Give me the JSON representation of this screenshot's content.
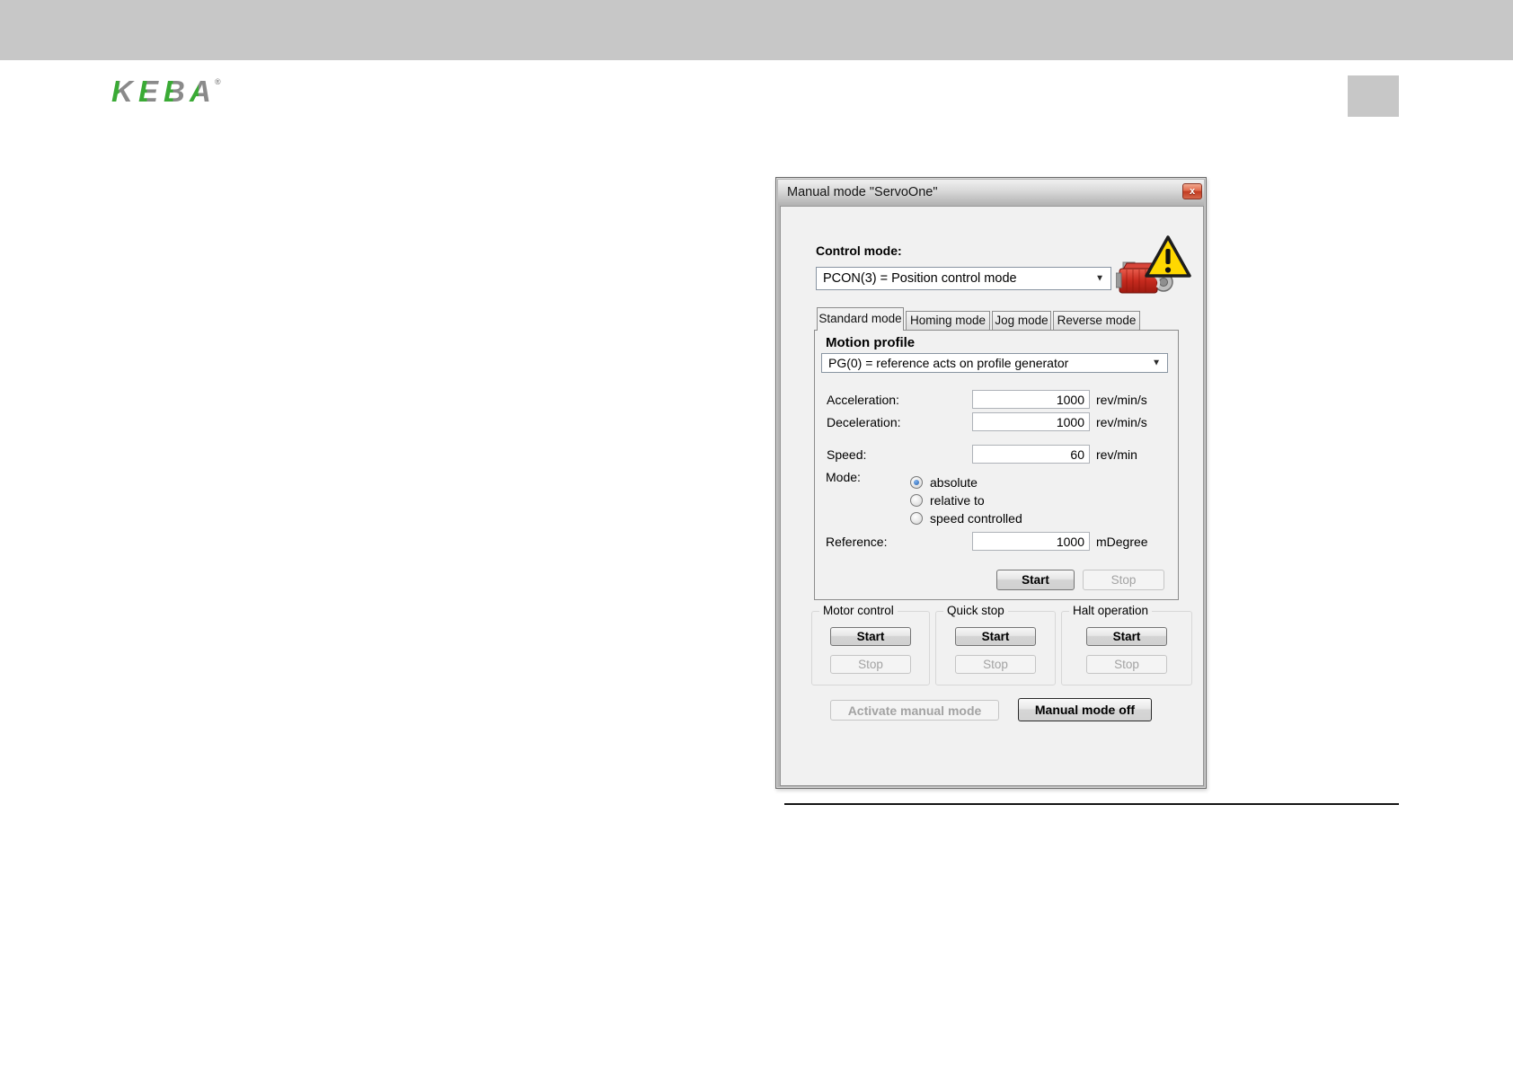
{
  "page": {
    "logo": {
      "letters": [
        "K",
        "E",
        "B",
        "A"
      ],
      "reg_mark": "®",
      "green": "#3aaa35",
      "gray": "#8a8a8a"
    },
    "top_bar_color": "#c7c7c7"
  },
  "icons": {
    "dropdown_arrow": "▼",
    "close_glyph": "x"
  },
  "dialog": {
    "title": "Manual mode \"ServoOne\"",
    "control_mode": {
      "label": "Control mode:",
      "value": "PCON(3) = Position control mode"
    },
    "tabs": [
      {
        "label": "Standard mode",
        "active": true
      },
      {
        "label": "Homing mode",
        "active": false
      },
      {
        "label": "Jog mode",
        "active": false
      },
      {
        "label": "Reverse mode",
        "active": false
      }
    ],
    "motion_profile": {
      "heading": "Motion profile",
      "value": "PG(0) = reference acts on profile generator"
    },
    "fields": [
      {
        "label": "Acceleration:",
        "value": "1000",
        "unit": "rev/min/s"
      },
      {
        "label": "Deceleration:",
        "value": "1000",
        "unit": "rev/min/s"
      },
      {
        "label": "Speed:",
        "value": "60",
        "unit": "rev/min"
      }
    ],
    "mode": {
      "label": "Mode:",
      "options": [
        {
          "label": "absolute",
          "selected": true
        },
        {
          "label": "relative to",
          "selected": false
        },
        {
          "label": "speed controlled",
          "selected": false
        }
      ]
    },
    "reference": {
      "label": "Reference:",
      "value": "1000",
      "unit": "mDegree"
    },
    "profile_buttons": {
      "start": "Start",
      "stop": "Stop"
    },
    "groups": [
      {
        "title": "Motor control",
        "start": "Start",
        "stop": "Stop"
      },
      {
        "title": "Quick stop",
        "start": "Start",
        "stop": "Stop"
      },
      {
        "title": "Halt operation",
        "start": "Start",
        "stop": "Stop"
      }
    ],
    "activate_button": "Activate manual mode",
    "mode_off_button": "Manual mode off",
    "status_colors": {
      "warning_yellow": "#ffd800",
      "motor_red": "#c62a1e",
      "close_red": "#d4553a"
    }
  }
}
